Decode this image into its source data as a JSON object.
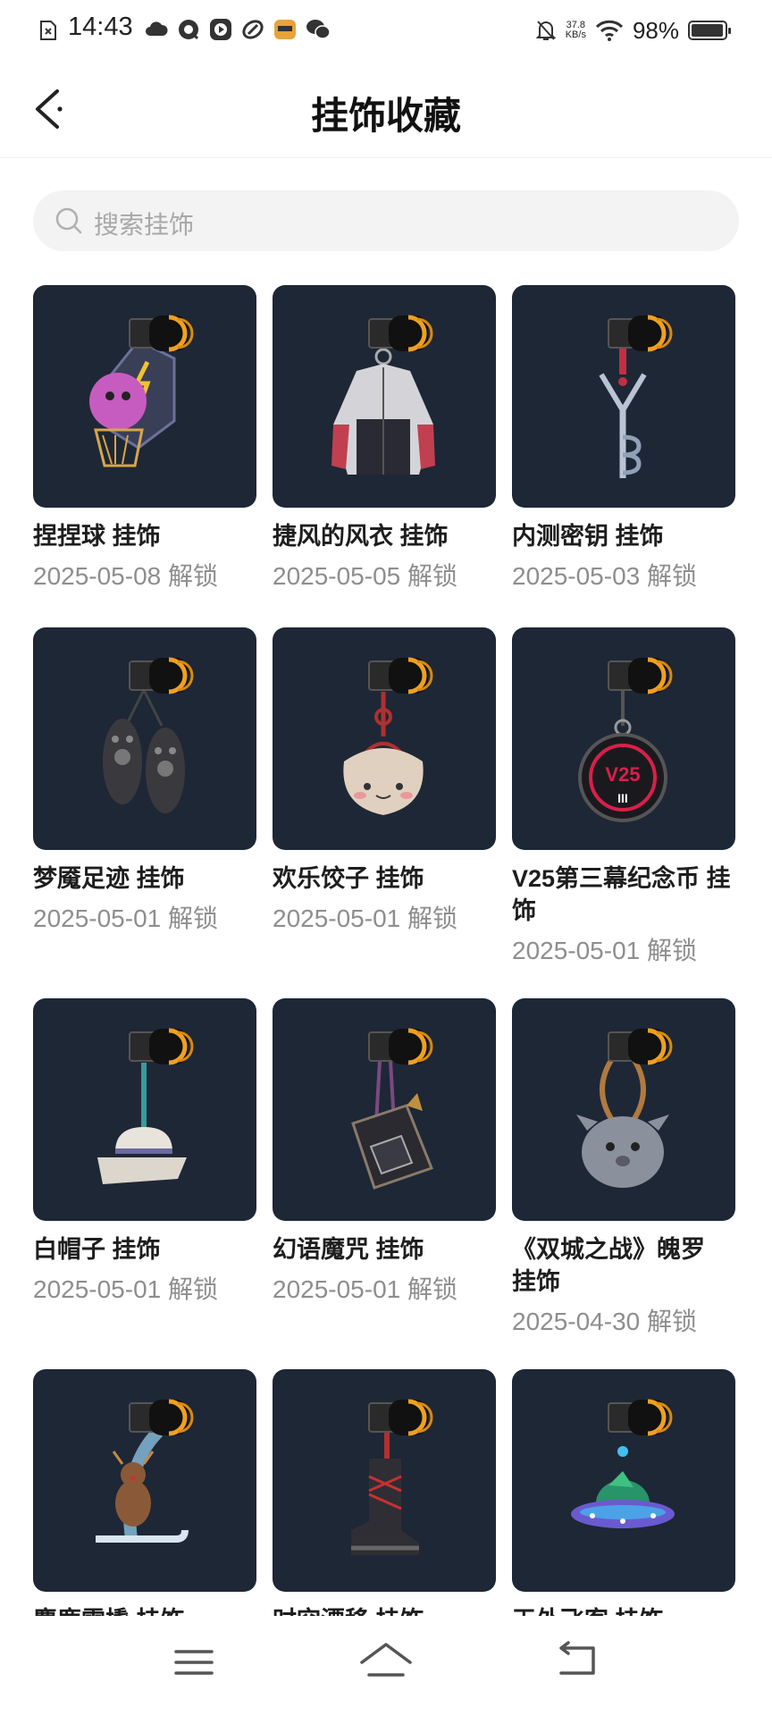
{
  "status_bar": {
    "time": "14:43",
    "net_speed_value": "37.8",
    "net_speed_unit": "KB/s",
    "battery": "98%",
    "battery_level": 0.98
  },
  "header": {
    "title": "挂饰收藏",
    "back_icon": "chevron-left-icon"
  },
  "search": {
    "placeholder": "搜索挂饰",
    "icon": "search-icon"
  },
  "items": [
    {
      "name": "捏捏球 挂饰",
      "date": "2025-05-08 解锁",
      "art": "ball"
    },
    {
      "name": "捷风的风衣 挂饰",
      "date": "2025-05-05 解锁",
      "art": "jacket"
    },
    {
      "name": "内测密钥 挂饰",
      "date": "2025-05-03 解锁",
      "art": "key"
    },
    {
      "name": "梦魇足迹 挂饰",
      "date": "2025-05-01 解锁",
      "art": "boots"
    },
    {
      "name": "欢乐饺子 挂饰",
      "date": "2025-05-01 解锁",
      "art": "dumpling"
    },
    {
      "name": "V25第三幕纪念币 挂饰",
      "date": "2025-05-01 解锁",
      "art": "coin",
      "coin_text": "V25",
      "coin_sub": "III"
    },
    {
      "name": "白帽子 挂饰",
      "date": "2025-05-01 解锁",
      "art": "hat"
    },
    {
      "name": "幻语魔咒 挂饰",
      "date": "2025-05-01 解锁",
      "art": "book"
    },
    {
      "name": "《双城之战》魄罗 挂饰",
      "date": "2025-04-30 解锁",
      "art": "poro"
    },
    {
      "name": "麋鹿雪橇 挂饰",
      "date": "",
      "art": "sled"
    },
    {
      "name": "时空漂移 挂饰",
      "date": "",
      "art": "boot"
    },
    {
      "name": "天外飞客 挂饰",
      "date": "",
      "art": "ufo"
    }
  ],
  "nav": {
    "menu_icon": "menu-icon",
    "home_icon": "home-icon",
    "back_icon": "back-icon"
  },
  "colors": {
    "thumb_bg": "#1e2736",
    "accent_ring": "#f0a020",
    "date_text": "#8e8e8e"
  }
}
